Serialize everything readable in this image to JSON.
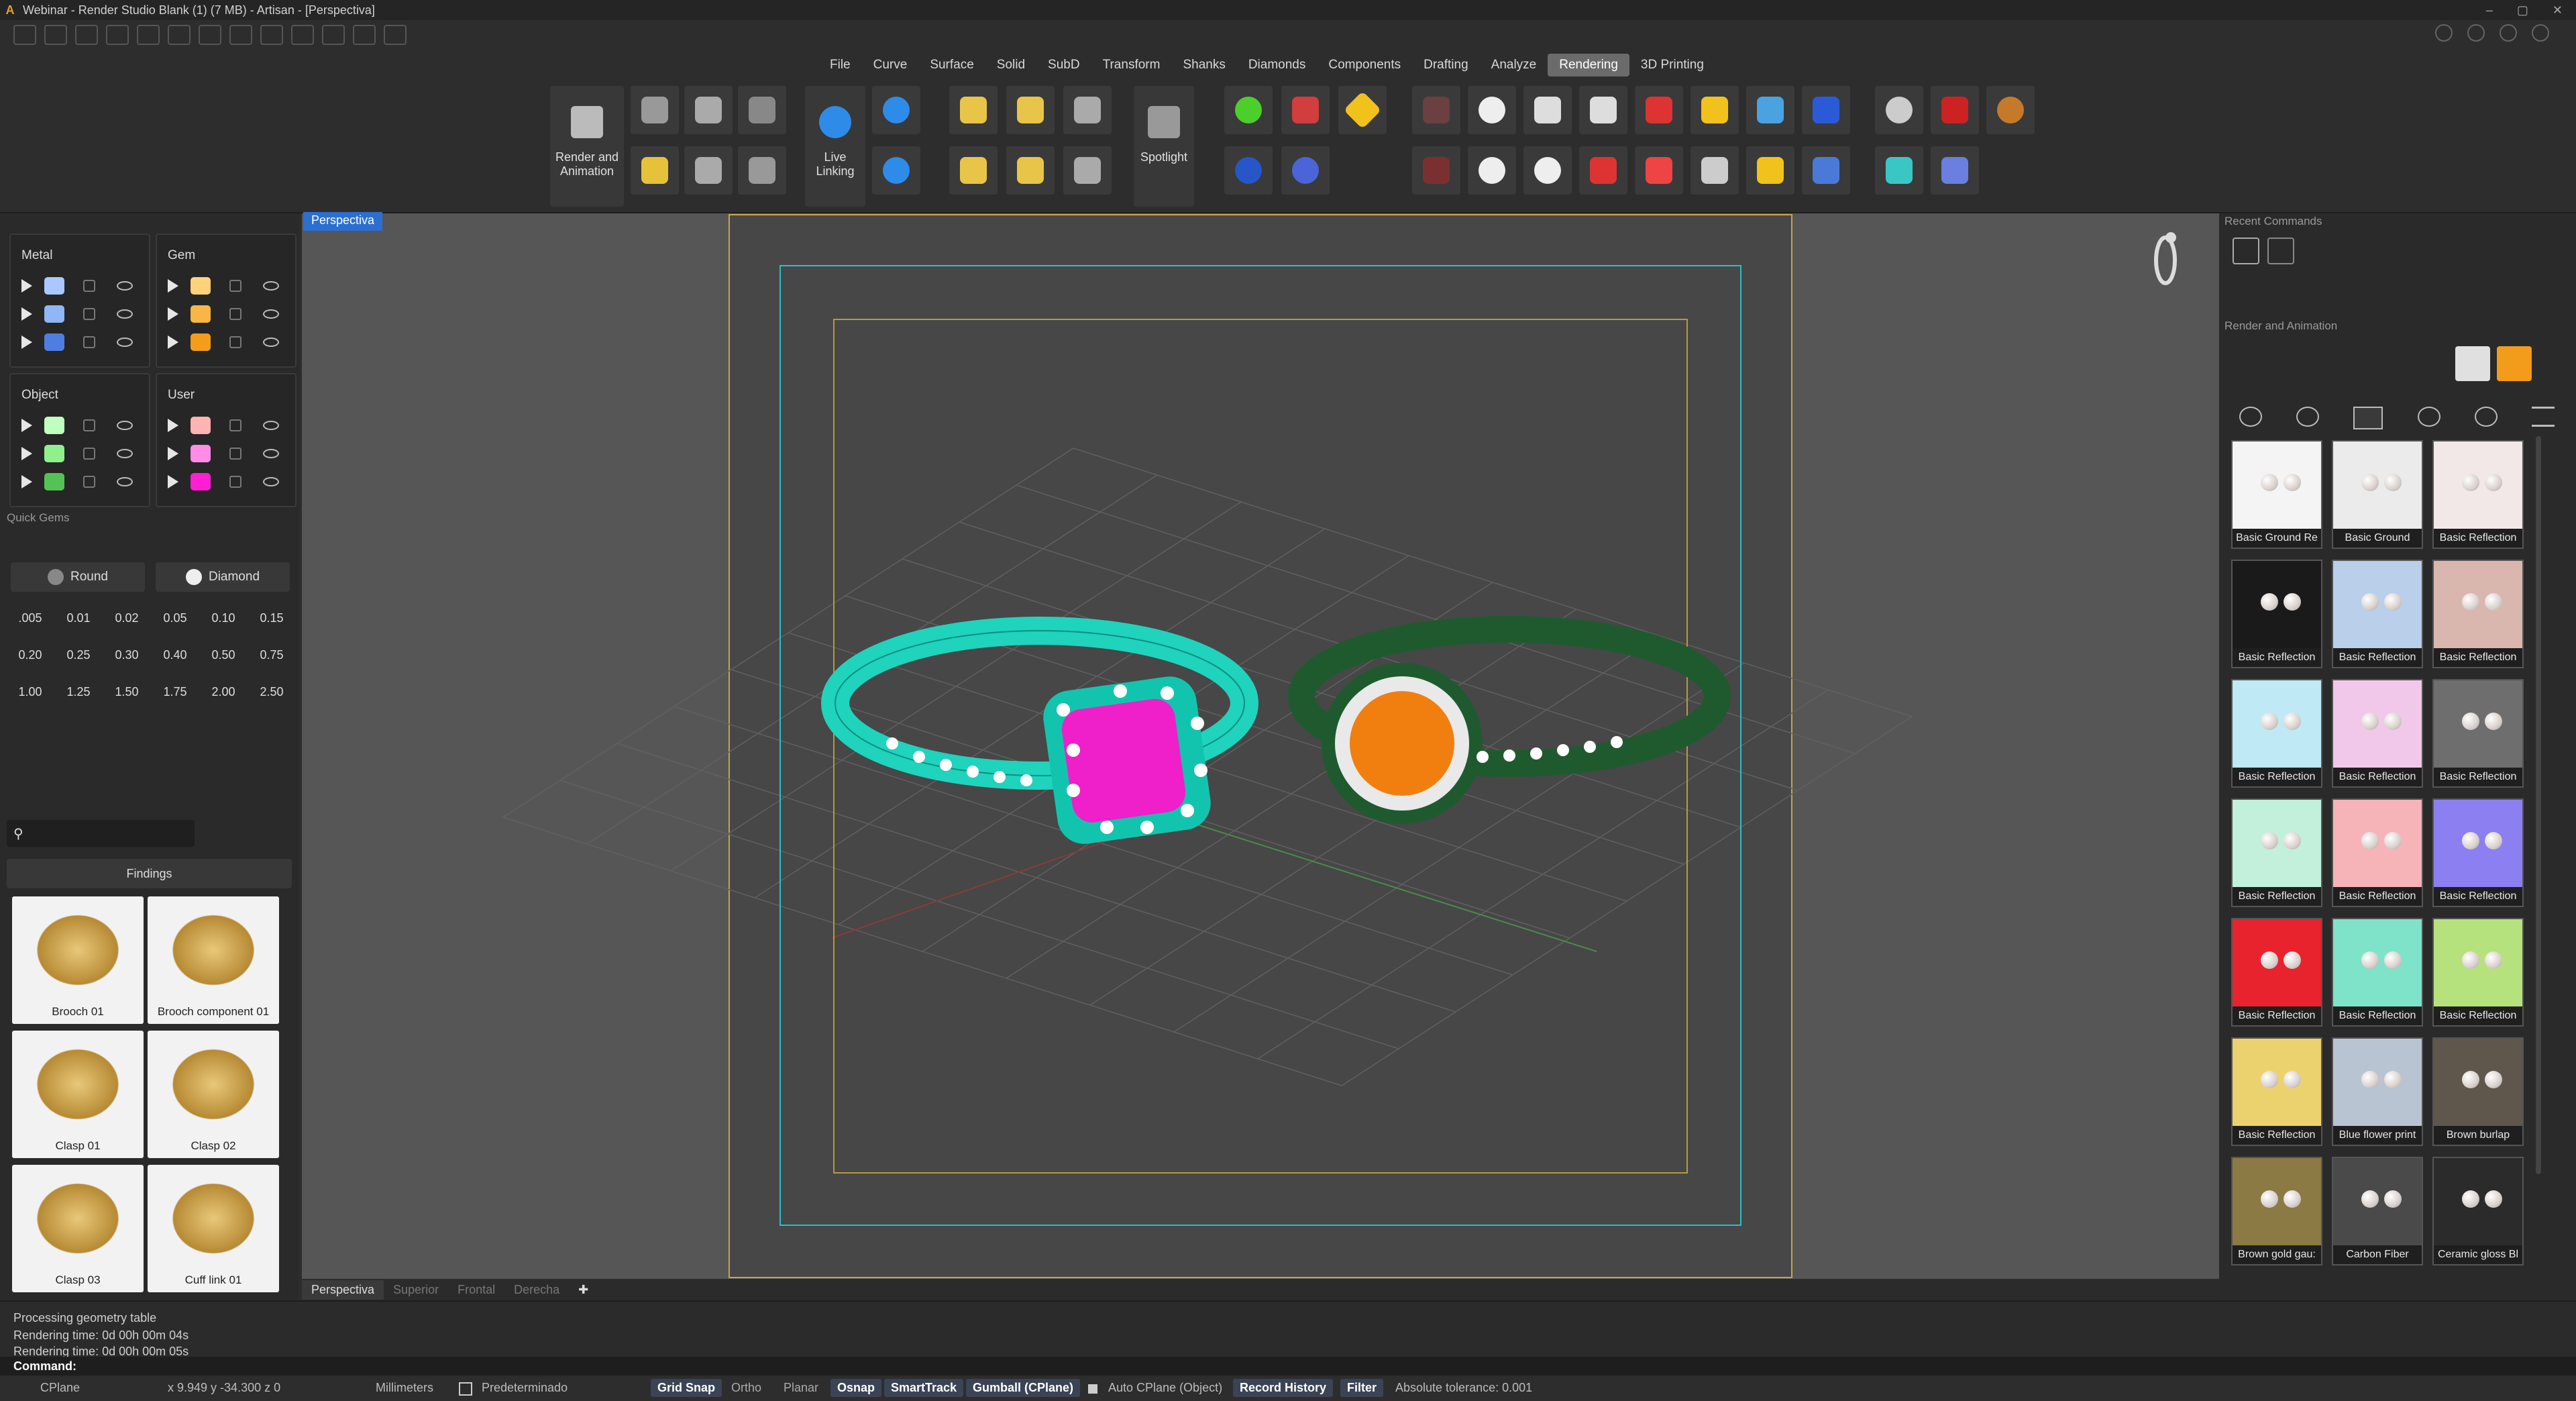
{
  "window": {
    "title": "Webinar - Render Studio Blank (1) (7 MB) - Artisan - [Perspectiva]"
  },
  "menu": [
    "File",
    "Curve",
    "Surface",
    "Solid",
    "SubD",
    "Transform",
    "Shanks",
    "Diamonds",
    "Components",
    "Drafting",
    "Analyze",
    "Rendering",
    "3D Printing"
  ],
  "menu_active": "Rendering",
  "ribbon": {
    "render_animation_label": "Render and Animation",
    "live_linking_label": "Live Linking",
    "spotlight_label": "Spotlight"
  },
  "layers": {
    "metal": {
      "title": "Metal",
      "colors": [
        "#a9c8ff",
        "#8fb6f5",
        "#4f7ee0"
      ]
    },
    "gem": {
      "title": "Gem",
      "colors": [
        "#ffd27a",
        "#f7b645",
        "#f49d1a"
      ]
    },
    "object": {
      "title": "Object",
      "colors": [
        "#bfffc0",
        "#8ff08c",
        "#55c255"
      ]
    },
    "user": {
      "title": "User",
      "colors": [
        "#ffb3b3",
        "#ff8ce6",
        "#ff1fd2"
      ]
    }
  },
  "quick_gems": {
    "title": "Quick Gems",
    "shape": "Round",
    "material": "Diamond",
    "sizes": [
      ".005",
      "0.01",
      "0.02",
      "0.05",
      "0.10",
      "0.15",
      "0.20",
      "0.25",
      "0.30",
      "0.40",
      "0.50",
      "0.75",
      "1.00",
      "1.25",
      "1.50",
      "1.75",
      "2.00",
      "2.50"
    ]
  },
  "findings": {
    "category": "Findings",
    "search_placeholder": "",
    "items": [
      "Brooch 01",
      "Brooch component 01",
      "Clasp 01",
      "Clasp 02",
      "Clasp 03",
      "Cuff link 01"
    ]
  },
  "viewport": {
    "active_name": "Perspectiva",
    "tabs": [
      "Perspectiva",
      "Superior",
      "Frontal",
      "Derecha"
    ]
  },
  "right_panel": {
    "recent_commands_title": "Recent Commands",
    "render_animation_title": "Render and Animation",
    "environments": [
      {
        "name": "Basic Ground Re",
        "bg": "#f4f4f4"
      },
      {
        "name": "Basic Ground",
        "bg": "#ebebeb"
      },
      {
        "name": "Basic Reflection",
        "bg": "#f3e8e8"
      },
      {
        "name": "Basic Reflection",
        "bg": "#1a1a1a"
      },
      {
        "name": "Basic Reflection",
        "bg": "#b9cfea"
      },
      {
        "name": "Basic Reflection",
        "bg": "#d9b7ae"
      },
      {
        "name": "Basic Reflection",
        "bg": "#bfe9f5"
      },
      {
        "name": "Basic Reflection",
        "bg": "#f2c8ea"
      },
      {
        "name": "Basic Reflection",
        "bg": "#6e6e6e"
      },
      {
        "name": "Basic Reflection",
        "bg": "#c3f0da"
      },
      {
        "name": "Basic Reflection",
        "bg": "#f7b4b8"
      },
      {
        "name": "Basic Reflection",
        "bg": "#8c7ff2"
      },
      {
        "name": "Basic Reflection",
        "bg": "#e8232e"
      },
      {
        "name": "Basic Reflection",
        "bg": "#7fe3c9"
      },
      {
        "name": "Basic Reflection",
        "bg": "#b6e27d"
      },
      {
        "name": "Basic Reflection",
        "bg": "#ecd26f"
      },
      {
        "name": "Blue flower print",
        "bg": "#b9c4d2"
      },
      {
        "name": "Brown burlap",
        "bg": "#5f574c"
      },
      {
        "name": "Brown gold gau:",
        "bg": "#8b7a44"
      },
      {
        "name": "Carbon Fiber",
        "bg": "#4a4a4a"
      },
      {
        "name": "Ceramic gloss Bl",
        "bg": "#2b2b2b"
      }
    ]
  },
  "command_history": [
    "Processing geometry table",
    "Rendering time: 0d 00h 00m 04s",
    "Rendering time: 0d 00h 00m 05s"
  ],
  "command_prompt": "Command:",
  "status": {
    "cplane": "CPlane",
    "coords": "x 9.949  y -34.300  z 0",
    "units": "Millimeters",
    "layer": "Predeterminado",
    "grid_snap": "Grid Snap",
    "ortho": "Ortho",
    "planar": "Planar",
    "osnap": "Osnap",
    "smarttrack": "SmartTrack",
    "gumball": "Gumball (CPlane)",
    "auto_cplane": "Auto CPlane (Object)",
    "record_history": "Record History",
    "filter": "Filter",
    "tolerance": "Absolute tolerance: 0.001"
  }
}
